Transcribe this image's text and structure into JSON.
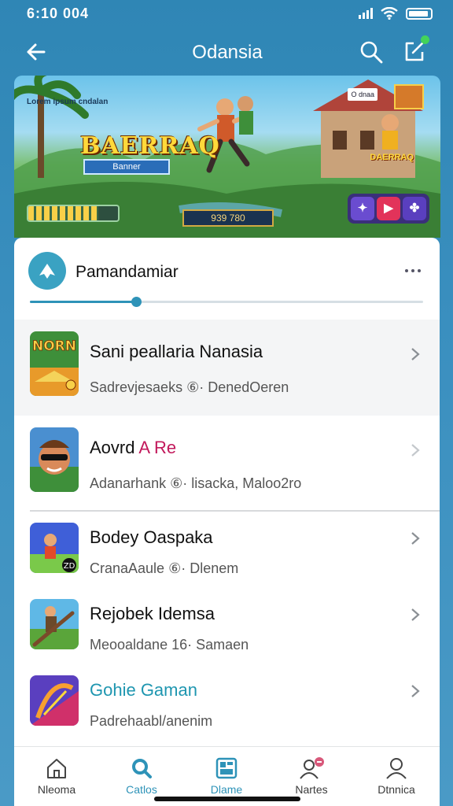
{
  "status_bar": {
    "time": "6:10 004"
  },
  "app_bar": {
    "title": "Odansia"
  },
  "banner": {
    "caption": "Lorem ipsum cndalan",
    "logo_text": "BAERRAQ",
    "sub_label": "Banner",
    "score_text": "939 780",
    "right_title": "DAERRAQ",
    "badge_text": "O dnaa",
    "progress_fraction": 0.78
  },
  "section": {
    "title": "Pamandamiar",
    "progress_fraction": 0.27
  },
  "list": [
    {
      "title": "Sani peallaria Nanasia",
      "meta": "Sadrevjesaeks  ⑥·  DenedOeren",
      "title_color": "#111111"
    },
    {
      "title": "Aovrd",
      "title_accent": "A Re",
      "meta": "Adanarhank  ⑥·  lisacka, Maloo2ro",
      "accent_color": "#c2185b"
    },
    {
      "title": "Bodey Oaspaka",
      "meta": "CranaAaule  ⑥·  Dlenem"
    },
    {
      "title": "Rejobek Idemsa",
      "meta": "Meooaldane 16·  Samaen"
    },
    {
      "title": "Gohie Gaman",
      "meta": "Padrehaabl/anenim",
      "title_color": "#1e96b0"
    }
  ],
  "bottom_nav": [
    {
      "label": "Nleoma",
      "icon": "home-icon"
    },
    {
      "label": "Catlos",
      "icon": "search-icon",
      "active": true
    },
    {
      "label": "Dlame",
      "icon": "grid-icon",
      "active": true
    },
    {
      "label": "Nartes",
      "icon": "people-icon"
    },
    {
      "label": "Dtnnica",
      "icon": "profile-icon"
    }
  ],
  "colors": {
    "accent": "#2e93b8",
    "background": "#2f86b5",
    "notification": "#43d35a"
  }
}
